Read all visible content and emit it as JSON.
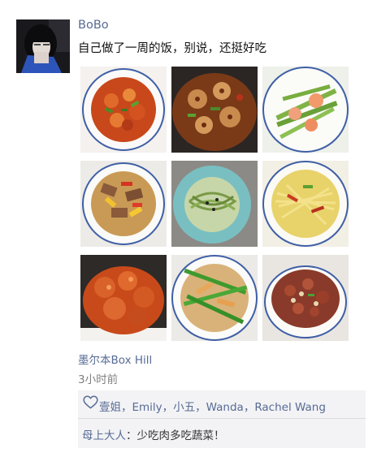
{
  "post": {
    "author": "BoBo",
    "text": "自己做了一周的饭，别说，还挺好吃",
    "location": "墨尔本Box Hill",
    "time": "3小时前"
  },
  "photos": [
    {
      "name": "dish-spicy-shrimp"
    },
    {
      "name": "dish-lotus-root-stirfry"
    },
    {
      "name": "dish-shrimp-asparagus"
    },
    {
      "name": "dish-beef-peppers"
    },
    {
      "name": "dish-spinach-noodles"
    },
    {
      "name": "dish-shredded-potato"
    },
    {
      "name": "dish-sweet-sour-pork"
    },
    {
      "name": "dish-tofu-chives"
    },
    {
      "name": "dish-diced-chicken"
    }
  ],
  "likes": {
    "icon": "heart-icon",
    "names": [
      "壹姐",
      "Emily",
      "小五",
      "Wanda",
      "Rachel Wang"
    ],
    "separator": "，"
  },
  "comments": [
    {
      "author": "母上大人",
      "colon": "：",
      "text": "少吃肉多吃蔬菜！"
    }
  ],
  "colors": {
    "link": "#576b95",
    "panel": "#f3f3f5"
  }
}
